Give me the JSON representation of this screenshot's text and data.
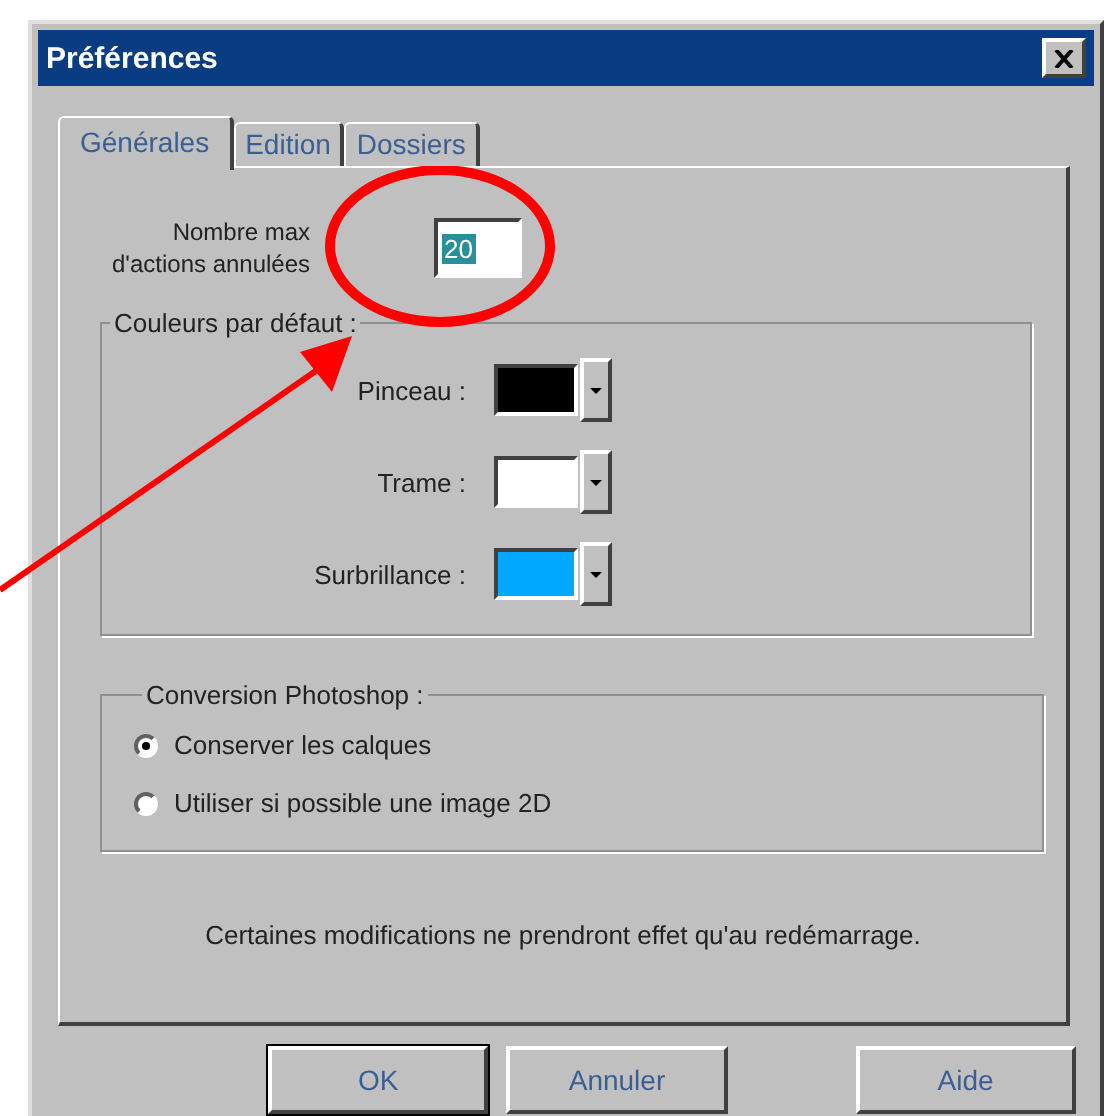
{
  "window": {
    "title": "Préférences"
  },
  "tabs": [
    {
      "label": "Générales",
      "selected": true
    },
    {
      "label": "Edition",
      "selected": false
    },
    {
      "label": "Dossiers",
      "selected": false
    }
  ],
  "max_actions": {
    "label": "Nombre max\nd'actions annulées",
    "value": "20",
    "value_selected": true
  },
  "default_colors": {
    "title": "Couleurs par défaut :",
    "rows": [
      {
        "label": "Pinceau :",
        "color": "#000000"
      },
      {
        "label": "Trame :",
        "color": "#ffffff"
      },
      {
        "label": "Surbrillance :",
        "color": "#00a8ff"
      }
    ]
  },
  "photoshop_conversion": {
    "title": "Conversion Photoshop :",
    "options": [
      {
        "label": "Conserver les calques",
        "selected": true
      },
      {
        "label": "Utiliser si possible une image 2D",
        "selected": false
      }
    ]
  },
  "note": "Certaines modifications ne prendront effet qu'au redémarrage.",
  "buttons": [
    {
      "label": "OK",
      "default": true
    },
    {
      "label": "Annuler",
      "default": false
    },
    {
      "label": "Aide",
      "default": false
    }
  ]
}
